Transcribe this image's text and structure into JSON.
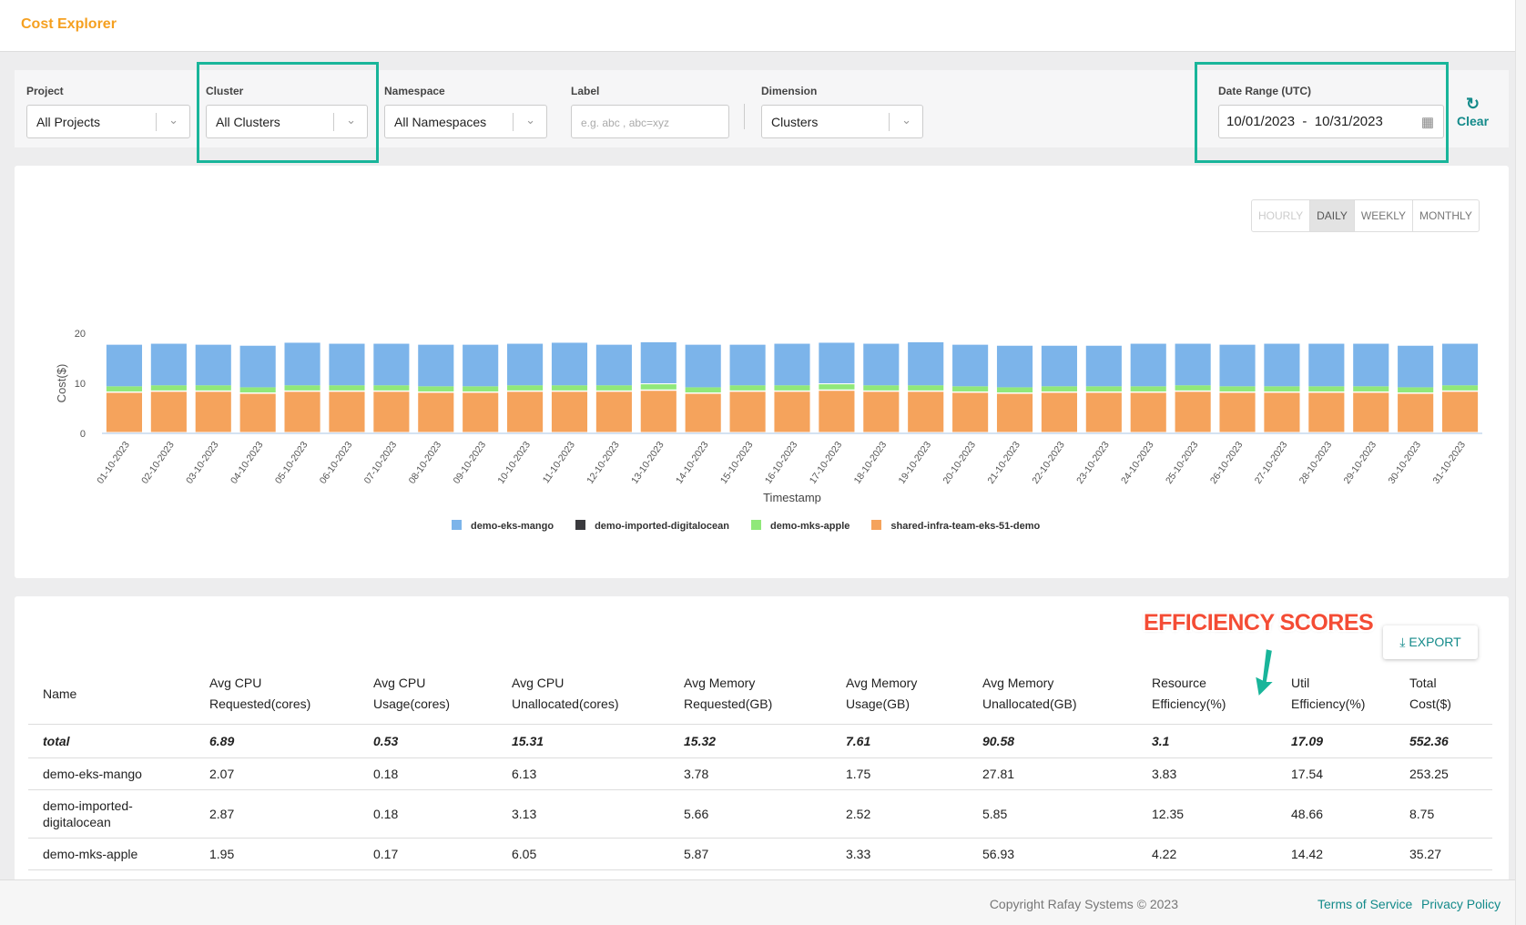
{
  "header": {
    "title": "Cost Explorer"
  },
  "filters": {
    "project": {
      "label": "Project",
      "value": "All Projects"
    },
    "cluster": {
      "label": "Cluster",
      "value": "All Clusters"
    },
    "namespace": {
      "label": "Namespace",
      "value": "All Namespaces"
    },
    "label": {
      "label": "Label",
      "placeholder": "e.g. abc , abc=xyz"
    },
    "dimension": {
      "label": "Dimension",
      "value": "Clusters"
    },
    "date_range": {
      "label": "Date Range (UTC)",
      "start": "10/01/2023",
      "sep": "-",
      "end": "10/31/2023"
    },
    "clear_label": "Clear"
  },
  "granularity": {
    "options": [
      "HOURLY",
      "DAILY",
      "WEEKLY",
      "MONTHLY"
    ],
    "selected": "DAILY",
    "disabled": [
      "HOURLY"
    ]
  },
  "chart_data": {
    "type": "bar",
    "stacked": true,
    "xlabel": "Timestamp",
    "ylabel": "Cost($)",
    "ylim": [
      0,
      20
    ],
    "yticks": [
      0,
      10,
      20
    ],
    "categories": [
      "01-10-2023",
      "02-10-2023",
      "03-10-2023",
      "04-10-2023",
      "05-10-2023",
      "06-10-2023",
      "07-10-2023",
      "08-10-2023",
      "09-10-2023",
      "10-10-2023",
      "11-10-2023",
      "12-10-2023",
      "13-10-2023",
      "14-10-2023",
      "15-10-2023",
      "16-10-2023",
      "17-10-2023",
      "18-10-2023",
      "19-10-2023",
      "20-10-2023",
      "21-10-2023",
      "22-10-2023",
      "23-10-2023",
      "24-10-2023",
      "25-10-2023",
      "26-10-2023",
      "27-10-2023",
      "28-10-2023",
      "29-10-2023",
      "30-10-2023",
      "31-10-2023"
    ],
    "legend_position": "bottom",
    "series": [
      {
        "name": "shared-infra-team-eks-51-demo",
        "color": "#f5a35c",
        "values": [
          8.1,
          8.3,
          8.3,
          7.9,
          8.3,
          8.3,
          8.3,
          8.1,
          8.1,
          8.3,
          8.3,
          8.3,
          8.5,
          7.9,
          8.3,
          8.3,
          8.5,
          8.3,
          8.3,
          8.1,
          7.9,
          8.1,
          8.1,
          8.1,
          8.3,
          8.1,
          8.1,
          8.1,
          8.1,
          7.9,
          8.3
        ]
      },
      {
        "name": "demo-mks-apple",
        "color": "#90e87a",
        "values": [
          1.3,
          1.3,
          1.3,
          1.3,
          1.3,
          1.3,
          1.3,
          1.3,
          1.3,
          1.3,
          1.3,
          1.3,
          1.3,
          1.3,
          1.3,
          1.3,
          1.3,
          1.3,
          1.3,
          1.3,
          1.3,
          1.3,
          1.3,
          1.3,
          1.3,
          1.3,
          1.3,
          1.3,
          1.3,
          1.3,
          1.3
        ]
      },
      {
        "name": "demo-imported-digitalocean",
        "color": "#3a3a3e",
        "values": [
          0,
          0,
          0,
          0,
          0,
          0,
          0,
          0,
          0,
          0,
          0,
          0,
          0.2,
          0,
          0,
          0,
          0.2,
          0,
          0,
          0,
          0,
          0,
          0,
          0,
          0,
          0,
          0,
          0,
          0,
          0,
          0
        ]
      },
      {
        "name": "demo-eks-mango",
        "color": "#7cb4ea",
        "values": [
          8.3,
          8.3,
          8.1,
          8.3,
          8.5,
          8.3,
          8.3,
          8.3,
          8.3,
          8.3,
          8.5,
          8.1,
          8.2,
          8.5,
          8.1,
          8.3,
          8.1,
          8.3,
          8.6,
          8.3,
          8.3,
          8.1,
          8.1,
          8.5,
          8.3,
          8.3,
          8.5,
          8.5,
          8.5,
          8.3,
          8.3
        ]
      }
    ],
    "legend_order": [
      "demo-eks-mango",
      "demo-imported-digitalocean",
      "demo-mks-apple",
      "shared-infra-team-eks-51-demo"
    ]
  },
  "annotation": {
    "text": "EFFICIENCY SCORES"
  },
  "table": {
    "export_label": "EXPORT",
    "headers": [
      [
        "Name"
      ],
      [
        "Avg CPU",
        "Requested(cores)"
      ],
      [
        "Avg CPU",
        "Usage(cores)"
      ],
      [
        "Avg CPU",
        "Unallocated(cores)"
      ],
      [
        "Avg Memory",
        "Requested(GB)"
      ],
      [
        "Avg Memory",
        "Usage(GB)"
      ],
      [
        "Avg Memory",
        "Unallocated(GB)"
      ],
      [
        "Resource",
        "Efficiency(%)"
      ],
      [
        "Util",
        "Efficiency(%)"
      ],
      [
        "Total",
        "Cost($)"
      ]
    ],
    "rows": [
      [
        "total",
        "6.89",
        "0.53",
        "15.31",
        "15.32",
        "7.61",
        "90.58",
        "3.1",
        "17.09",
        "552.36"
      ],
      [
        "demo-eks-mango",
        "2.07",
        "0.18",
        "6.13",
        "3.78",
        "1.75",
        "27.81",
        "3.83",
        "17.54",
        "253.25"
      ],
      [
        "demo-imported-digitalocean",
        "2.87",
        "0.18",
        "3.13",
        "5.66",
        "2.52",
        "5.85",
        "12.35",
        "48.66",
        "8.75"
      ],
      [
        "demo-mks-apple",
        "1.95",
        "0.17",
        "6.05",
        "5.87",
        "3.33",
        "56.93",
        "4.22",
        "14.42",
        "35.27"
      ]
    ]
  },
  "footer": {
    "copyright": "Copyright Rafay Systems © 2023",
    "terms": "Terms of Service",
    "privacy": "Privacy Policy"
  }
}
